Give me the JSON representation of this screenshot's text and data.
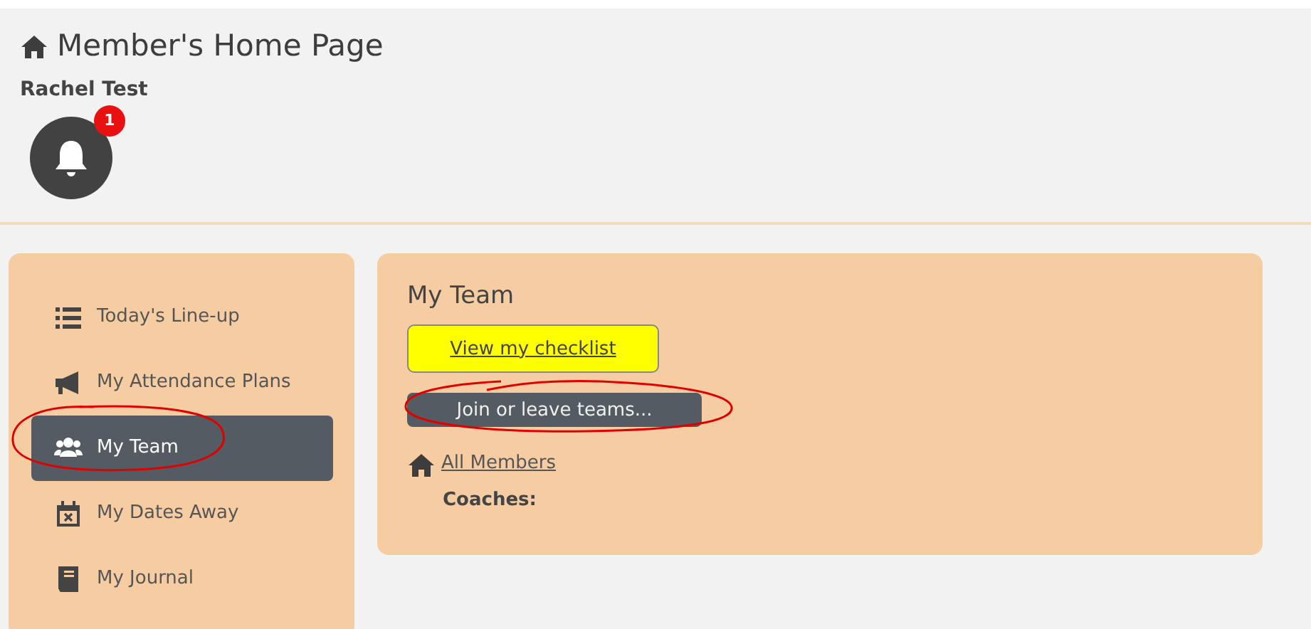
{
  "header": {
    "title": "Member's Home Page",
    "user_name": "Rachel Test",
    "notifications": {
      "count": "1"
    }
  },
  "sidebar": {
    "items": [
      {
        "label": "Today's Line-up",
        "kind": "list",
        "selected": false
      },
      {
        "label": "My Attendance Plans",
        "kind": "megaphone",
        "selected": false
      },
      {
        "label": "My Team",
        "kind": "users",
        "selected": true
      },
      {
        "label": "My Dates Away",
        "kind": "calendar",
        "selected": false
      },
      {
        "label": "My Journal",
        "kind": "book",
        "selected": false
      }
    ]
  },
  "panel": {
    "title": "My Team",
    "checklist_button": "View my checklist",
    "teams_button": "Join or leave teams...",
    "members_link": "All Members",
    "coaches_label": "Coaches:"
  }
}
